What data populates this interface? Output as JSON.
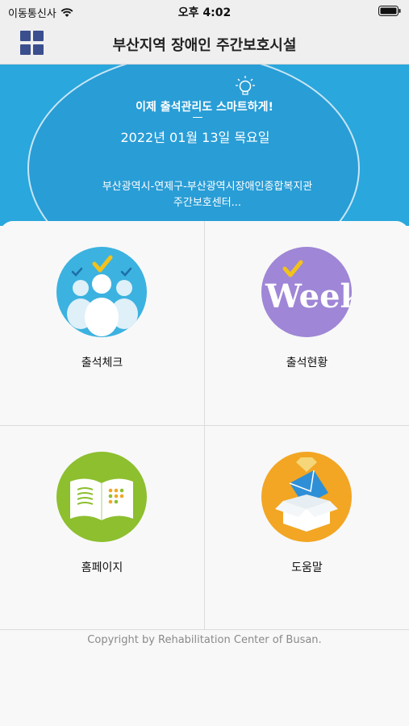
{
  "status_bar": {
    "carrier": "이동통신사",
    "time": "오후 4:02",
    "wifi_icon": "wifi-icon",
    "battery_icon": "battery-icon"
  },
  "nav": {
    "title": "부산지역 장애인 주간보호시설",
    "menu_icon": "grid-menu-icon"
  },
  "banner": {
    "slogan": "이제 출석관리도 스마트하게!",
    "date": "2022년 01월 13일 목요일",
    "org_line1": "부산광역시-연제구-부산광역시장애인종합복지관",
    "org_line2": "주간보호센터..."
  },
  "menu": [
    {
      "label": "출석체크",
      "icon": "attendance-check-icon",
      "color": "#3cb2e0"
    },
    {
      "label": "출석현황",
      "icon": "week-calendar-icon",
      "color": "#9f86d6",
      "icon_text": "Week"
    },
    {
      "label": "홈페이지",
      "icon": "book-icon",
      "color": "#8dbf2f"
    },
    {
      "label": "도움말",
      "icon": "help-box-icon",
      "color": "#f2a623"
    }
  ],
  "footer": {
    "copyright": "Copyright by Rehabilitation Center of Busan."
  },
  "colors": {
    "banner": "#2aa7dc",
    "nav_icon": "#3b4f8e"
  }
}
